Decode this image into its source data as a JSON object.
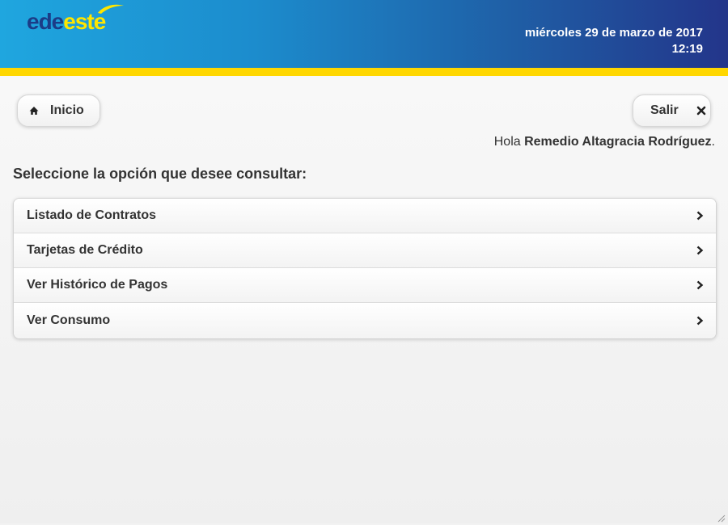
{
  "header": {
    "logo_part1": "ede",
    "logo_part2": "este",
    "date": "miércoles 29 de marzo de 2017",
    "time": "12:19"
  },
  "toolbar": {
    "home_label": "Inicio",
    "home_icon": "home-icon",
    "logout_label": "Salir",
    "logout_icon": "close-icon"
  },
  "greeting": {
    "prefix": "Hola ",
    "user_name": "Remedio Altagracia Rodríguez",
    "suffix": "."
  },
  "prompt": "Seleccione la opción que desee consultar:",
  "menu": {
    "items": [
      {
        "label": "Listado de Contratos",
        "icon": "chevron-right-icon"
      },
      {
        "label": "Tarjetas de Crédito",
        "icon": "chevron-right-icon"
      },
      {
        "label": "Ver Histórico de Pagos",
        "icon": "chevron-right-icon"
      },
      {
        "label": "Ver Consumo",
        "icon": "chevron-right-icon"
      }
    ]
  },
  "colors": {
    "header_start": "#1fa6df",
    "header_end": "#23358a",
    "accent_stripe": "#ffd700",
    "logo_dark": "#1b3c87",
    "logo_yellow": "#ffe600",
    "text": "#333333"
  }
}
